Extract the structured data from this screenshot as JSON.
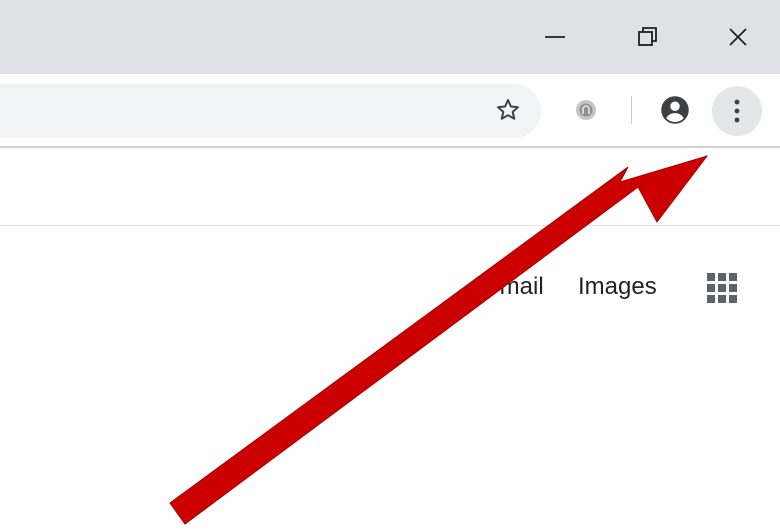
{
  "titlebar": {
    "icons": {
      "minimize": "minimize-icon",
      "restore": "restore-icon",
      "close": "close-icon"
    }
  },
  "toolbar": {
    "icons": {
      "bookmark": "star-icon",
      "extension": "extension-icon",
      "profile": "account-circle-icon",
      "menu": "three-dots-vertical-icon"
    }
  },
  "google_nav": {
    "gmail_label": "Gmail",
    "images_label": "Images",
    "apps_icon": "apps-grid-icon"
  },
  "annotation": {
    "arrow_color": "#cc0000",
    "points_to": "menu"
  },
  "colors": {
    "titlebar": "#dee1e6",
    "omnibox": "#f1f3f4",
    "menu_highlight": "#e4e6e9",
    "text": "#222222",
    "icon": "#5f6368"
  }
}
